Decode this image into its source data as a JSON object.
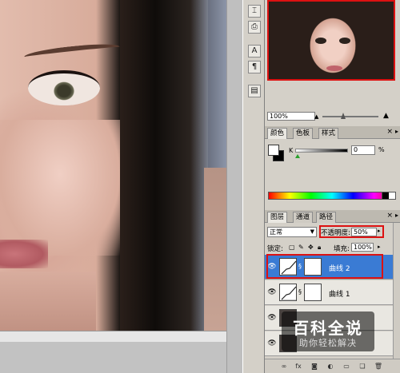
{
  "navigator": {
    "zoom": "100%"
  },
  "color_panel": {
    "tabs": [
      "颜色",
      "色板",
      "样式"
    ],
    "channel_label": "K",
    "channel_value": "0",
    "channel_unit": "%"
  },
  "layers_panel": {
    "tabs": [
      "图层",
      "通道",
      "路径"
    ],
    "blend_mode": "正常",
    "opacity_label": "不透明度:",
    "opacity_value": "50%",
    "lock_label": "锁定:",
    "fill_label": "填充:",
    "fill_value": "100%",
    "layers": [
      {
        "name": "曲线 2",
        "selected": true
      },
      {
        "name": "曲线 1",
        "selected": false
      }
    ]
  },
  "tool_icons": [
    "text-tool-icon",
    "stamp-tool-icon",
    "character-panel-icon",
    "paragraph-panel-icon",
    "layer-comps-icon"
  ],
  "watermark": {
    "title": "百科全说",
    "subtitle": "助你轻松解决"
  }
}
